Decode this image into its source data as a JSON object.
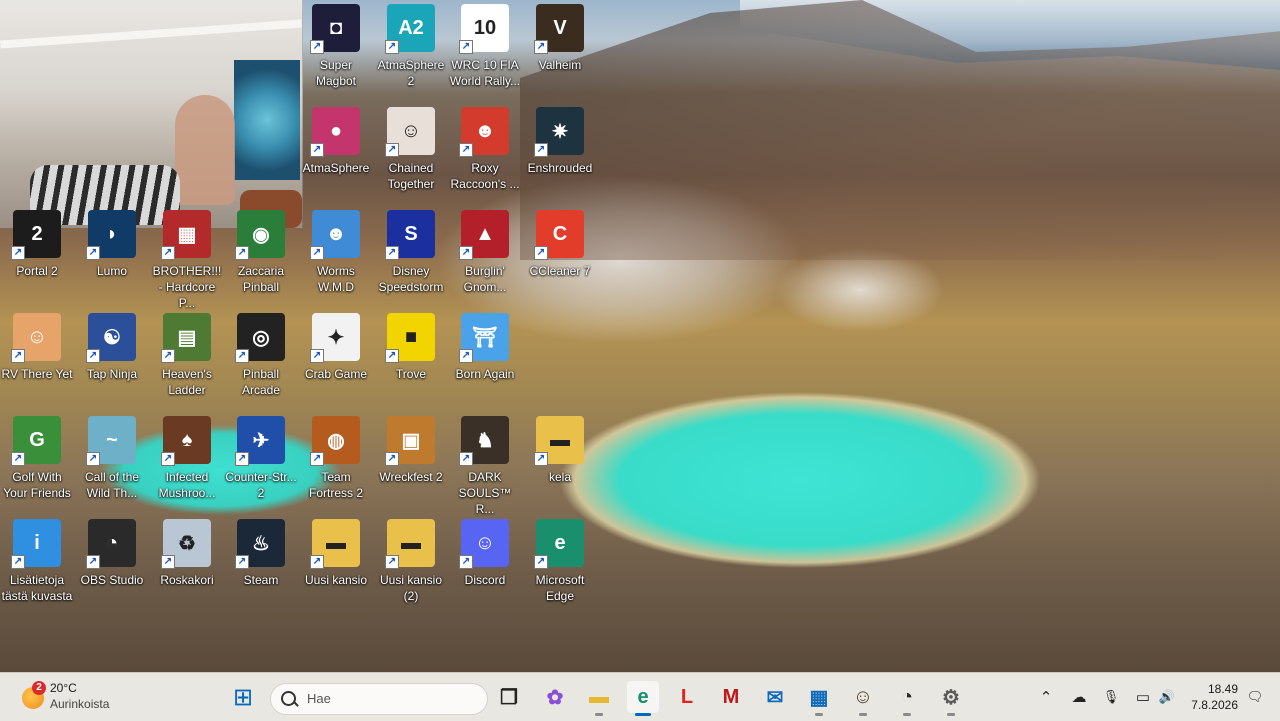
{
  "desktop": {
    "icons": [
      {
        "label": "Super Magbot",
        "color": "#1e1e3a",
        "glyph": "◘"
      },
      {
        "label": "AtmaSphere 2",
        "color": "#1aa6b8",
        "glyph": "A2"
      },
      {
        "label": "WRC 10 FIA World Rally...",
        "color": "#ffffff",
        "glyph": "10"
      },
      {
        "label": "Valheim",
        "color": "#3a2c1e",
        "glyph": "V"
      },
      {
        "label": "AtmaSphere",
        "color": "#c4356e",
        "glyph": "●"
      },
      {
        "label": "Chained Together",
        "color": "#e8e0d8",
        "glyph": "☺"
      },
      {
        "label": "Roxy Raccoon's ...",
        "color": "#d33b2c",
        "glyph": "☻"
      },
      {
        "label": "Enshrouded",
        "color": "#1d3440",
        "glyph": "✷"
      },
      {
        "label": "Portal 2",
        "color": "#1c1c1c",
        "glyph": "2"
      },
      {
        "label": "Lumo",
        "color": "#0f3b66",
        "glyph": "◗"
      },
      {
        "label": "BROTHER!!! - Hardcore P...",
        "color": "#b22a2a",
        "glyph": "▦"
      },
      {
        "label": "Zaccaria Pinball",
        "color": "#2b7d3a",
        "glyph": "◉"
      },
      {
        "label": "Worms W.M.D",
        "color": "#3f8bd6",
        "glyph": "☻"
      },
      {
        "label": "Disney Speedstorm",
        "color": "#1b2f9e",
        "glyph": "S"
      },
      {
        "label": "Burglin' Gnom...",
        "color": "#b3202a",
        "glyph": "▲"
      },
      {
        "label": "CCleaner 7",
        "color": "#e23d2b",
        "glyph": "C"
      },
      {
        "label": "RV There Yet",
        "color": "#e6a36a",
        "glyph": "☺"
      },
      {
        "label": "Tap Ninja",
        "color": "#2c4f9a",
        "glyph": "☯"
      },
      {
        "label": "Heaven's Ladder",
        "color": "#4f7a34",
        "glyph": "▤"
      },
      {
        "label": "Pinball Arcade",
        "color": "#222222",
        "glyph": "◎"
      },
      {
        "label": "Crab Game",
        "color": "#f2f2f2",
        "glyph": "✦"
      },
      {
        "label": "Trove",
        "color": "#f2d400",
        "glyph": "■"
      },
      {
        "label": "Born Again",
        "color": "#4aa3e8",
        "glyph": "⛩"
      },
      {
        "label": "Golf With Your Friends",
        "color": "#3a8f3a",
        "glyph": "G"
      },
      {
        "label": "Call of the Wild Th...",
        "color": "#6fb0c9",
        "glyph": "~"
      },
      {
        "label": "Infected Mushroo...",
        "color": "#6a3a22",
        "glyph": "♠"
      },
      {
        "label": "Counter-Str... 2",
        "color": "#1f4fa8",
        "glyph": "✈"
      },
      {
        "label": "Team Fortress 2",
        "color": "#b55b1e",
        "glyph": "◍"
      },
      {
        "label": "Wreckfest 2",
        "color": "#c07a2e",
        "glyph": "▣"
      },
      {
        "label": "DARK SOULS™ R...",
        "color": "#3a3028",
        "glyph": "♞"
      },
      {
        "label": "kela",
        "color": "#e9c04a",
        "glyph": "▬"
      },
      {
        "label": "Lisätietoja tästä kuvasta",
        "color": "#2f8fe0",
        "glyph": "i"
      },
      {
        "label": "OBS Studio",
        "color": "#2a2a2a",
        "glyph": "◔"
      },
      {
        "label": "Roskakori",
        "color": "#b9c6d3",
        "glyph": "♻"
      },
      {
        "label": "Steam",
        "color": "#1b2838",
        "glyph": "♨"
      },
      {
        "label": "Uusi kansio",
        "color": "#e9c04a",
        "glyph": "▬"
      },
      {
        "label": "Uusi kansio (2)",
        "color": "#e9c04a",
        "glyph": "▬"
      },
      {
        "label": "Discord",
        "color": "#5865f2",
        "glyph": "☺"
      },
      {
        "label": "Microsoft Edge",
        "color": "#1a8f6e",
        "glyph": "e"
      }
    ]
  },
  "taskbar": {
    "weather": {
      "badge": "2",
      "temp": "20°C",
      "condition": "Aurinkoista"
    },
    "search_placeholder": "Hae",
    "apps": [
      {
        "name": "start",
        "glyph": "⊞",
        "color": "#0067c0"
      },
      {
        "name": "task-view",
        "glyph": "❐",
        "color": "#222222"
      },
      {
        "name": "copilot",
        "glyph": "✿",
        "color": "#8a4fd8"
      },
      {
        "name": "file-explorer",
        "glyph": "▬",
        "color": "#e9b832"
      },
      {
        "name": "edge",
        "glyph": "e",
        "color": "#1a8f6e"
      },
      {
        "name": "lenovo",
        "glyph": "L",
        "color": "#e2231a"
      },
      {
        "name": "mcafee",
        "glyph": "M",
        "color": "#c01818"
      },
      {
        "name": "outlook",
        "glyph": "✉",
        "color": "#0f6cbd"
      },
      {
        "name": "store",
        "glyph": "▦",
        "color": "#0f6cbd"
      },
      {
        "name": "game-avatar",
        "glyph": "☺",
        "color": "#5a4030"
      },
      {
        "name": "obs",
        "glyph": "◔",
        "color": "#2a2a2a"
      },
      {
        "name": "settings",
        "glyph": "⚙",
        "color": "#5a5a5a"
      }
    ],
    "tray": {
      "chevron": "⌃",
      "network": "☁",
      "mic": "🎙",
      "display": "▭",
      "volume": "🔊",
      "notification": "🗨"
    },
    "clock": {
      "time": "18.49",
      "date": "7.8.2026"
    }
  }
}
